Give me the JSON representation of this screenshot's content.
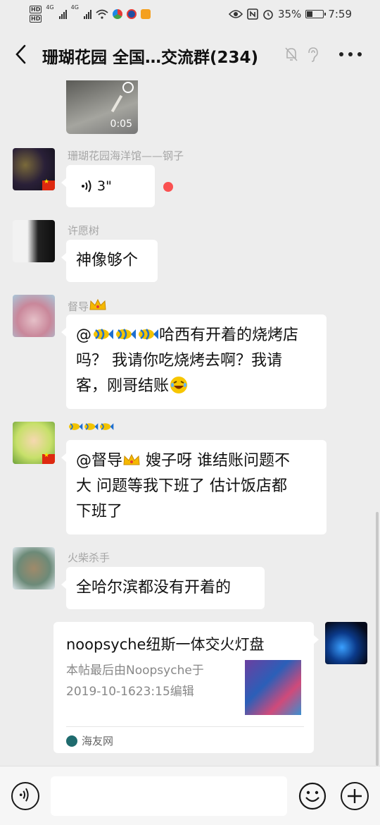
{
  "status_bar": {
    "hd1": "HD",
    "hd2": "HD",
    "sig1_label": "4G",
    "sig2_label": "4G",
    "battery_percent": "35%",
    "battery_level": 0.35,
    "time": "7:59"
  },
  "header": {
    "title": "珊瑚花园 全国…交流群(234)"
  },
  "messages": {
    "video": {
      "duration": "0:05"
    },
    "m1": {
      "nickname": "珊瑚花园海洋馆——钢子",
      "voice_length": "3\""
    },
    "m2": {
      "nickname": "许愿树",
      "text": "神像够个"
    },
    "m3": {
      "nickname": "督导",
      "line1_prefix": "@",
      "line1_suffix": "哈西有开着的烧烤店",
      "line2": "吗？ 我请你吃烧烤去啊？我请",
      "line3": "客，刚哥结账"
    },
    "m4": {
      "line1_prefix": "@督导",
      "line1_suffix": " 嫂子呀 谁结账问题不",
      "line2": "大 问题等我下班了 估计饭店都",
      "line3": "下班了"
    },
    "m5": {
      "nickname": "火柴杀手",
      "text": "全哈尔滨都没有开着的"
    },
    "card": {
      "title": "noopsyche纽斯一体交火灯盘",
      "desc": "本帖最后由Noopsyche于2019-10-1623:15编辑",
      "source": "海友网"
    }
  },
  "colors": {
    "background": "#ededed",
    "bubble": "#ffffff",
    "nickname": "#a6a6a6",
    "unread_dot": "#fa5151"
  },
  "icons": [
    "back-icon",
    "mute-icon",
    "ear-icon",
    "more-icon",
    "voice-icon",
    "emoji-icon",
    "plus-icon"
  ]
}
